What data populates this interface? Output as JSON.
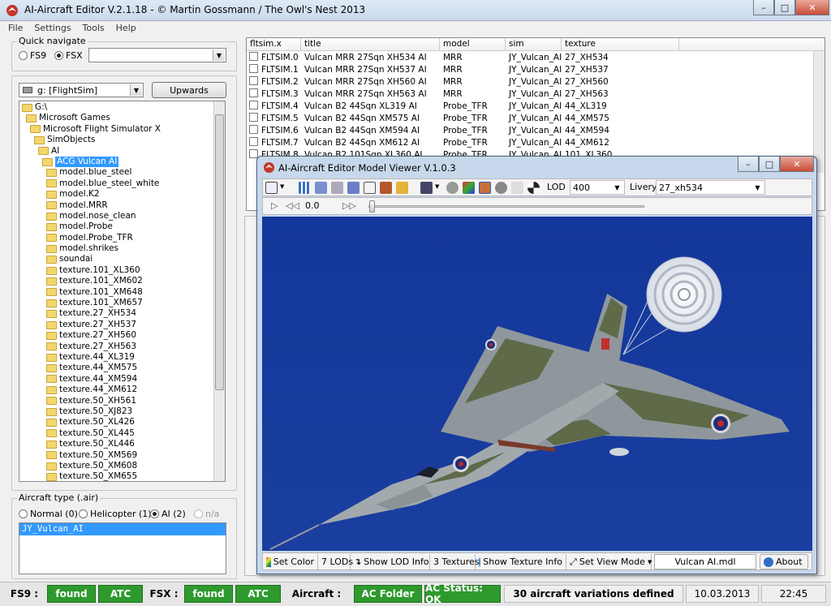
{
  "window": {
    "title": "AI-Aircraft Editor V.2.1.18  -  © Martin Gossmann / The Owl's Nest 2013",
    "controls": [
      "minimize",
      "maximize",
      "close"
    ]
  },
  "menu": [
    "File",
    "Settings",
    "Tools",
    "Help"
  ],
  "quick_navigate": {
    "label": "Quick navigate",
    "options": [
      {
        "label": "FS9",
        "checked": false
      },
      {
        "label": "FSX",
        "checked": true
      }
    ],
    "combo_value": ""
  },
  "drive": {
    "value": "g: [FlightSim]",
    "upwards_label": "Upwards"
  },
  "tree": {
    "nodes": [
      {
        "label": "G:\\",
        "indent": 0
      },
      {
        "label": "Microsoft Games",
        "indent": 1
      },
      {
        "label": "Microsoft Flight Simulator X",
        "indent": 2
      },
      {
        "label": "SimObjects",
        "indent": 3
      },
      {
        "label": "AI",
        "indent": 4
      },
      {
        "label": "ACG Vulcan AI",
        "indent": 5,
        "selected": true
      },
      {
        "label": "model.blue_steel",
        "indent": 6
      },
      {
        "label": "model.blue_steel_white",
        "indent": 6
      },
      {
        "label": "model.K2",
        "indent": 6
      },
      {
        "label": "model.MRR",
        "indent": 6
      },
      {
        "label": "model.nose_clean",
        "indent": 6
      },
      {
        "label": "model.Probe",
        "indent": 6
      },
      {
        "label": "model.Probe_TFR",
        "indent": 6
      },
      {
        "label": "model.shrikes",
        "indent": 6
      },
      {
        "label": "soundai",
        "indent": 6
      },
      {
        "label": "texture.101_XL360",
        "indent": 6
      },
      {
        "label": "texture.101_XM602",
        "indent": 6
      },
      {
        "label": "texture.101_XM648",
        "indent": 6
      },
      {
        "label": "texture.101_XM657",
        "indent": 6
      },
      {
        "label": "texture.27_XH534",
        "indent": 6
      },
      {
        "label": "texture.27_XH537",
        "indent": 6
      },
      {
        "label": "texture.27_XH560",
        "indent": 6
      },
      {
        "label": "texture.27_XH563",
        "indent": 6
      },
      {
        "label": "texture.44_XL319",
        "indent": 6
      },
      {
        "label": "texture.44_XM575",
        "indent": 6
      },
      {
        "label": "texture.44_XM594",
        "indent": 6
      },
      {
        "label": "texture.44_XM612",
        "indent": 6
      },
      {
        "label": "texture.50_XH561",
        "indent": 6
      },
      {
        "label": "texture.50_XJ823",
        "indent": 6
      },
      {
        "label": "texture.50_XL426",
        "indent": 6
      },
      {
        "label": "texture.50_XL445",
        "indent": 6
      },
      {
        "label": "texture.50_XL446",
        "indent": 6
      },
      {
        "label": "texture.50_XM569",
        "indent": 6
      },
      {
        "label": "texture.50_XM608",
        "indent": 6
      },
      {
        "label": "texture.50_XM655",
        "indent": 6
      }
    ]
  },
  "aircraft_type": {
    "label": "Aircraft type (.air)",
    "options": [
      {
        "label": "Normal (0)",
        "checked": false
      },
      {
        "label": "Helicopter (1)",
        "checked": false
      },
      {
        "label": "AI (2)",
        "checked": true
      },
      {
        "label": "n/a",
        "checked": false
      }
    ],
    "list": [
      "JY_Vulcan_AI"
    ]
  },
  "grid": {
    "columns": [
      "fltsim.x",
      "title",
      "model",
      "sim",
      "texture"
    ],
    "rows": [
      [
        "FLTSIM.0",
        "Vulcan MRR 27Sqn XH534 AI",
        "MRR",
        "JY_Vulcan_AI",
        "27_XH534"
      ],
      [
        "FLTSIM.1",
        "Vulcan MRR 27Sqn XH537 AI",
        "MRR",
        "JY_Vulcan_AI",
        "27_XH537"
      ],
      [
        "FLTSIM.2",
        "Vulcan MRR 27Sqn XH560 AI",
        "MRR",
        "JY_Vulcan_AI",
        "27_XH560"
      ],
      [
        "FLTSIM.3",
        "Vulcan MRR 27Sqn XH563 AI",
        "MRR",
        "JY_Vulcan_AI",
        "27_XH563"
      ],
      [
        "FLTSIM.4",
        "Vulcan B2 44Sqn XL319 AI",
        "Probe_TFR",
        "JY_Vulcan_AI",
        "44_XL319"
      ],
      [
        "FLTSIM.5",
        "Vulcan B2 44Sqn XM575 AI",
        "Probe_TFR",
        "JY_Vulcan_AI",
        "44_XM575"
      ],
      [
        "FLTSIM.6",
        "Vulcan B2 44Sqn XM594 AI",
        "Probe_TFR",
        "JY_Vulcan_AI",
        "44_XM594"
      ],
      [
        "FLTSIM.7",
        "Vulcan B2 44Sqn XM612 AI",
        "Probe_TFR",
        "JY_Vulcan_AI",
        "44_XM612"
      ],
      [
        "FLTSIM.8",
        "Vulcan B2 101Sqn XL360 AI",
        "Probe_TFR",
        "JY_Vulcan_AI",
        "101_XL360"
      ]
    ]
  },
  "viewer": {
    "title": "AI-Aircraft Editor Model Viewer V.1.0.3",
    "lod_label": "LOD",
    "lod_value": "400",
    "livery_label": "Livery",
    "livery_value": "27_xh534",
    "time_value": "0.0",
    "bottom": {
      "set_color": "Set Color",
      "lods": "7 LODs",
      "show_lod_info": "Show LOD Info",
      "textures": "3 Textures",
      "show_texture_info": "Show Texture Info",
      "set_view_mode": "Set View Mode",
      "model_file": "Vulcan AI.mdl",
      "about": "About"
    },
    "colors": {
      "background": "#1a3fa0",
      "camo_dark": "#5f6a4c",
      "camo_light": "#9aa0a4"
    }
  },
  "statusbar": {
    "fs9_label": "FS9 :",
    "fs9_found": "found",
    "fs9_atc": "ATC",
    "fsx_label": "FSX :",
    "fsx_found": "found",
    "fsx_atc": "ATC",
    "aircraft_label": "Aircraft :",
    "ac_folder": "AC Folder",
    "ac_status": "AC Status: OK",
    "variations": "30 aircraft variations defined",
    "date": "10.03.2013",
    "time": "22:45",
    "ok_color": "#2e9a2e"
  }
}
